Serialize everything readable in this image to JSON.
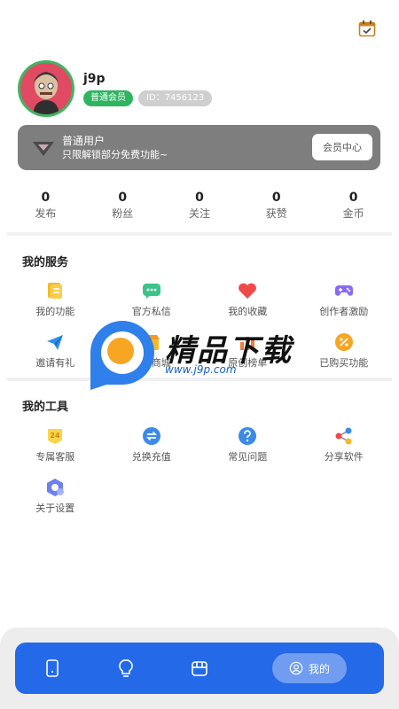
{
  "profile": {
    "username": "j9p",
    "member_badge": "普通会员",
    "id_label": "ID：7456123"
  },
  "vip": {
    "title": "普通用户",
    "subtitle": "只限解锁部分免费功能~",
    "button": "会员中心"
  },
  "stats": [
    {
      "value": "0",
      "label": "发布"
    },
    {
      "value": "0",
      "label": "粉丝"
    },
    {
      "value": "0",
      "label": "关注"
    },
    {
      "value": "0",
      "label": "获赞"
    },
    {
      "value": "0",
      "label": "金币"
    }
  ],
  "services": {
    "title": "我的服务",
    "items": [
      {
        "label": "我的功能",
        "icon": "document-icon"
      },
      {
        "label": "官方私信",
        "icon": "chat-icon"
      },
      {
        "label": "我的收藏",
        "icon": "heart-icon"
      },
      {
        "label": "创作者激励",
        "icon": "gamepad-icon"
      },
      {
        "label": "邀请有礼",
        "icon": "paper-plane-icon"
      },
      {
        "label": "我的商城",
        "icon": "shop-icon"
      },
      {
        "label": "原创榜单",
        "icon": "ranking-icon"
      },
      {
        "label": "已购买功能",
        "icon": "discount-icon"
      }
    ]
  },
  "tools": {
    "title": "我的工具",
    "items": [
      {
        "label": "专属客服",
        "icon": "24h-service-icon",
        "icon_text": "24"
      },
      {
        "label": "兑换充值",
        "icon": "exchange-icon"
      },
      {
        "label": "常见问题",
        "icon": "question-icon"
      },
      {
        "label": "分享软件",
        "icon": "share-icon"
      },
      {
        "label": "关于设置",
        "icon": "settings-icon"
      }
    ]
  },
  "watermark": {
    "title": "精品下载",
    "url": "www.j9p.com"
  },
  "nav": {
    "active_label": "我的",
    "items": [
      "phone-icon",
      "bulb-icon",
      "box-icon",
      "user-icon"
    ]
  },
  "colors": {
    "accent": "#2469e8",
    "member_green": "#2fb460",
    "vip_card": "#7e7e7e"
  }
}
